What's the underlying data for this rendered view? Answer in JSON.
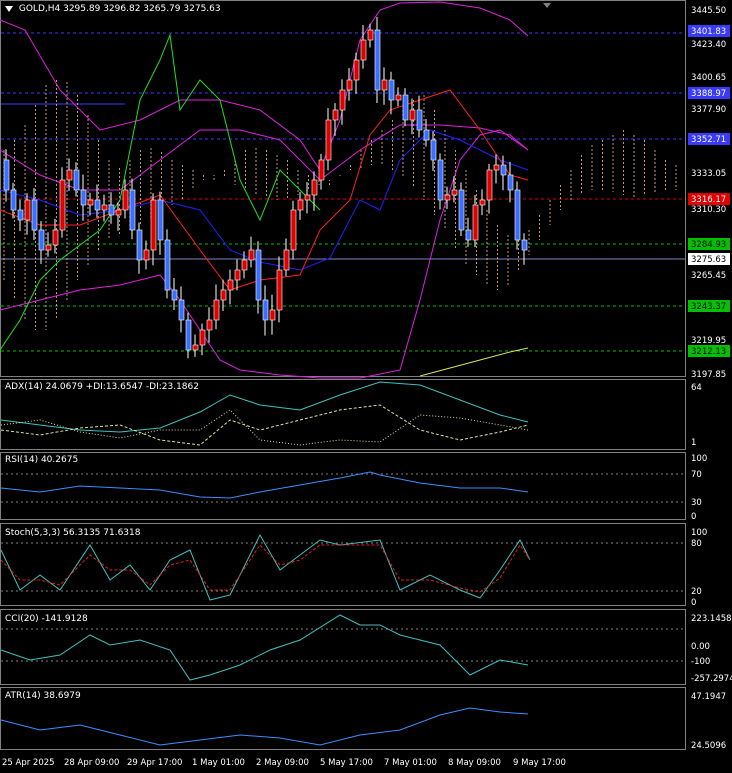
{
  "header": {
    "symbol": "GOLD,H4",
    "open": "3295.89",
    "high": "3296.82",
    "low": "3265.79",
    "close": "3275.63"
  },
  "price_axis": {
    "ticks": [
      "3445.50",
      "3423.40",
      "3400.65",
      "3377.90",
      "3333.05",
      "3310.30",
      "3265.45",
      "3219.95",
      "3197.85"
    ],
    "tags": [
      {
        "label": "3401.83",
        "color": "#3a3aff",
        "text_color": "#ffffff"
      },
      {
        "label": "3388.97",
        "color": "#3a3aff",
        "text_color": "#ffffff"
      },
      {
        "label": "3352.71",
        "color": "#3a3aff",
        "text_color": "#ffffff"
      },
      {
        "label": "3316.17",
        "color": "#e00000",
        "text_color": "#ffffff"
      },
      {
        "label": "3284.93",
        "color": "#00c000",
        "text_color": "#000000"
      },
      {
        "label": "3275.63",
        "color": "#ffffff",
        "text_color": "#000000"
      },
      {
        "label": "3243.37",
        "color": "#00c000",
        "text_color": "#000000"
      },
      {
        "label": "3212.13",
        "color": "#00c000",
        "text_color": "#000000"
      }
    ]
  },
  "panels": {
    "adx": {
      "title": "ADX(14) 24.0679 +DI:13.6547 -DI:23.1862",
      "scale": [
        "64",
        "1"
      ]
    },
    "rsi": {
      "title": "RSI(14) 40.2675",
      "scale": [
        "100",
        "70",
        "30",
        "0"
      ]
    },
    "stoch": {
      "title": "Stoch(5,3,3) 56.3135 71.6318",
      "scale": [
        "100",
        "80",
        "20",
        "0"
      ]
    },
    "cci": {
      "title": "CCI(20) -141.9128",
      "scale": [
        "223.1458",
        "0.00",
        "-100",
        "-257.2974"
      ]
    },
    "atr": {
      "title": "ATR(14) 38.6979",
      "scale": [
        "47.1947",
        "24.5096"
      ]
    }
  },
  "time_axis": [
    "25 Apr 2025",
    "28 Apr 09:00",
    "29 Apr 17:00",
    "1 May 01:00",
    "2 May 09:00",
    "5 May 17:00",
    "7 May 01:00",
    "8 May 09:00",
    "9 May 17:00"
  ],
  "colors": {
    "background": "#000000",
    "bull_candle": "#e00000",
    "bear_candle": "#3a6fff",
    "grid_line": "#808080",
    "bollinger": "#e020e0",
    "cloud": "#f0c090"
  }
}
